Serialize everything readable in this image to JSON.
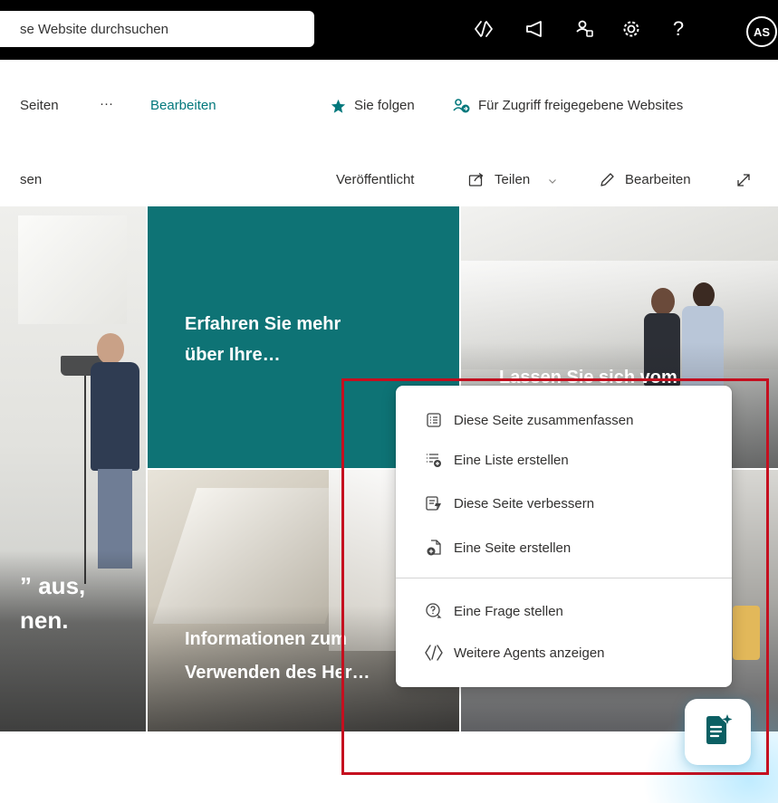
{
  "suite_bar": {
    "search_placeholder": "se Website durchsuchen",
    "avatar_initials": "AS"
  },
  "site_nav": {
    "pages_label": "Seiten",
    "more_label": "···",
    "edit_label": "Bearbeiten",
    "following_label": "Sie folgen",
    "shared_sites_label": "Für Zugriff freigegebene Websites"
  },
  "command_bar": {
    "left_fragment": "sen",
    "published_label": "Veröffentlicht",
    "share_label": "Teilen",
    "edit_label": "Bearbeiten"
  },
  "hero": {
    "tile_left_line1": "” aus,",
    "tile_left_line2": "nen.",
    "tile_teal_line1": "Erfahren Sie mehr",
    "tile_teal_line2": "über Ihre…",
    "tile_right_line1": "Lassen Sie sich vom",
    "tile_bottom_line1": "Informationen zum",
    "tile_bottom_line2": "Verwenden des Her…"
  },
  "context_menu": {
    "items": [
      {
        "label": "Diese Seite zusammenfassen",
        "icon": "summary-list-icon"
      },
      {
        "label": "Eine Liste erstellen",
        "icon": "create-list-icon"
      },
      {
        "label": "Diese Seite verbessern",
        "icon": "improve-page-icon"
      },
      {
        "label": "Eine Seite erstellen",
        "icon": "create-page-icon"
      },
      {
        "label": "Eine Frage stellen",
        "icon": "ask-question-icon"
      },
      {
        "label": "Weitere Agents anzeigen",
        "icon": "agents-icon"
      }
    ]
  },
  "colors": {
    "suite_bar": "#000000",
    "accent_teal": "#03787c",
    "tile_teal": "#0e7375",
    "highlight": "#c50f1f"
  }
}
